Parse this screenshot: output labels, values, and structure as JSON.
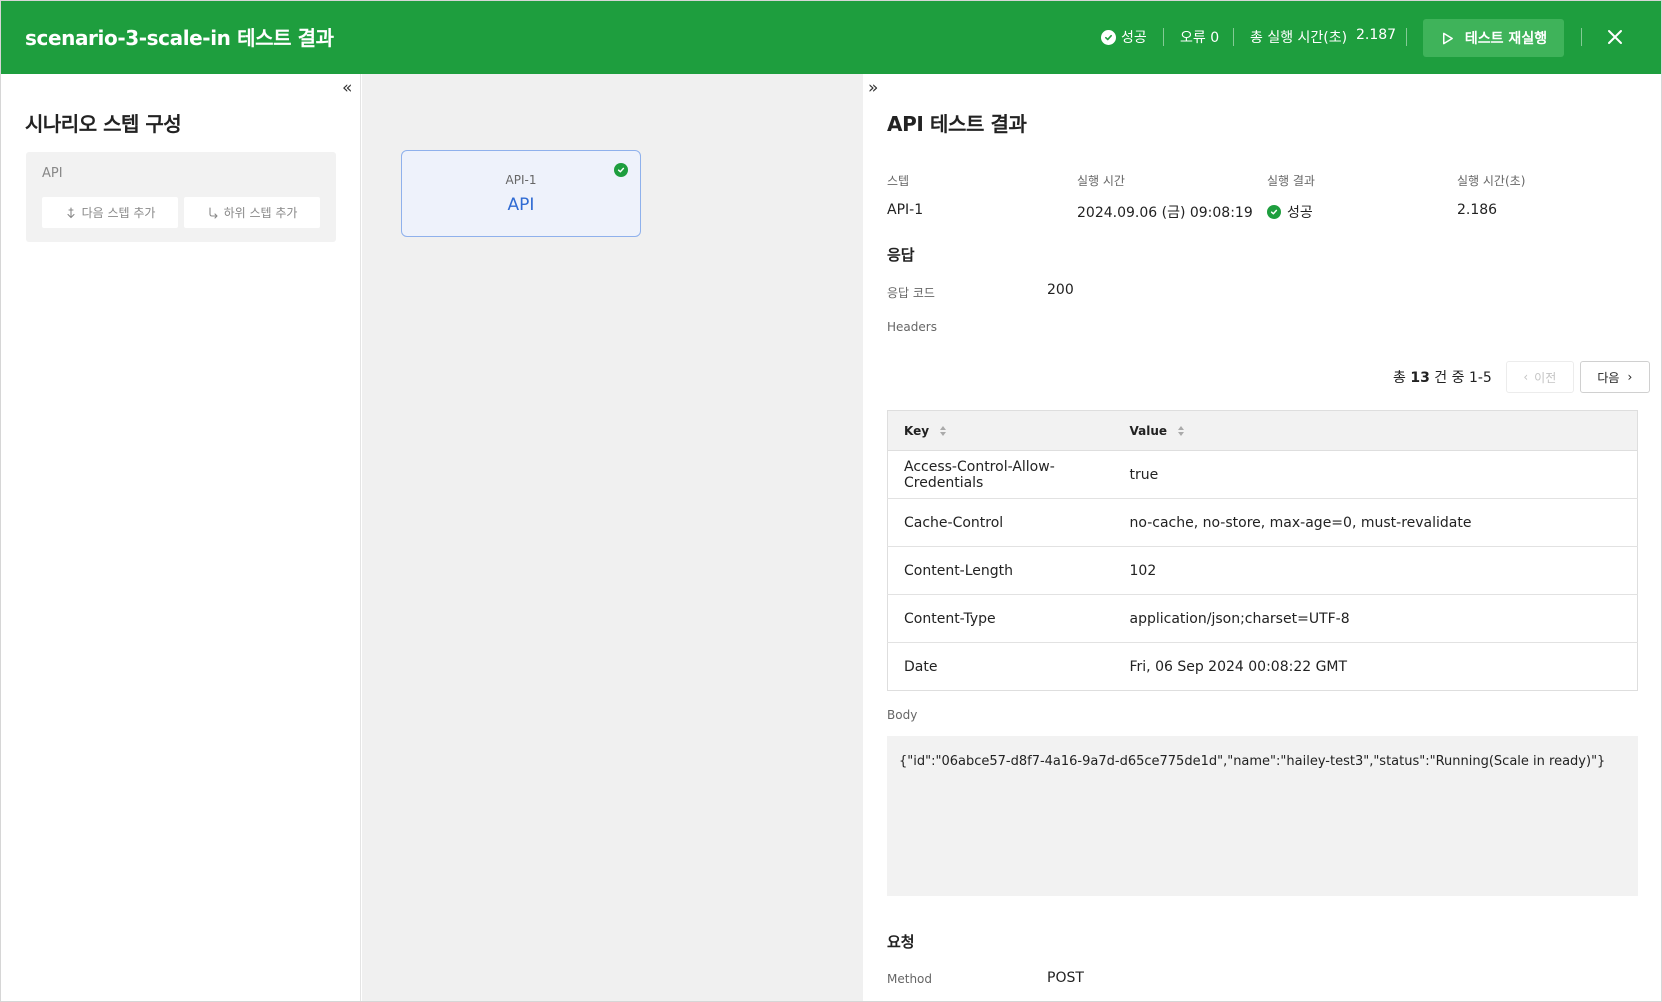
{
  "header": {
    "title": "scenario-3-scale-in 테스트 결과",
    "status_label": "성공",
    "errors_label": "오류 0",
    "total_time_label": "총 실행 시간(초)",
    "total_time_value": "2.187",
    "rerun_label": "테스트 재실행",
    "brand_color": "#1e9e3e"
  },
  "left": {
    "collapse_icon": "«",
    "title": "시나리오 스텝 구성",
    "step": {
      "name": "API",
      "add_next_label": "다음 스텝 추가",
      "add_child_label": "하위 스텝 추가"
    }
  },
  "canvas": {
    "node": {
      "id": "API-1",
      "type": "API",
      "status": "success"
    }
  },
  "right": {
    "collapse_icon": "»",
    "title": "API 테스트 결과",
    "meta": {
      "step_label": "스텝",
      "step_value": "API-1",
      "exec_time_label": "실행 시간",
      "exec_time_value": "2024.09.06 (금) 09:08:19",
      "result_label": "실행 결과",
      "result_value": "성공",
      "duration_label": "실행 시간(초)",
      "duration_value": "2.186"
    },
    "response": {
      "section_title": "응답",
      "code_label": "응답 코드",
      "code_value": "200",
      "headers_label": "Headers",
      "pager": {
        "prefix": "총",
        "total": "13",
        "suffix": "건 중 1-5",
        "prev_label": "이전",
        "next_label": "다음"
      },
      "columns": [
        "Key",
        "Value"
      ],
      "rows": [
        {
          "key": "Access-Control-Allow-Credentials",
          "value": "true"
        },
        {
          "key": "Cache-Control",
          "value": "no-cache, no-store, max-age=0, must-revalidate"
        },
        {
          "key": "Content-Length",
          "value": "102"
        },
        {
          "key": "Content-Type",
          "value": "application/json;charset=UTF-8"
        },
        {
          "key": "Date",
          "value": "Fri, 06 Sep 2024 00:08:22 GMT"
        }
      ],
      "body_label": "Body",
      "body_value": "{\"id\":\"06abce57-d8f7-4a16-9a7d-d65ce775de1d\",\"name\":\"hailey-test3\",\"status\":\"Running(Scale in ready)\"}"
    },
    "request": {
      "section_title": "요청",
      "method_label": "Method",
      "method_value": "POST"
    }
  }
}
